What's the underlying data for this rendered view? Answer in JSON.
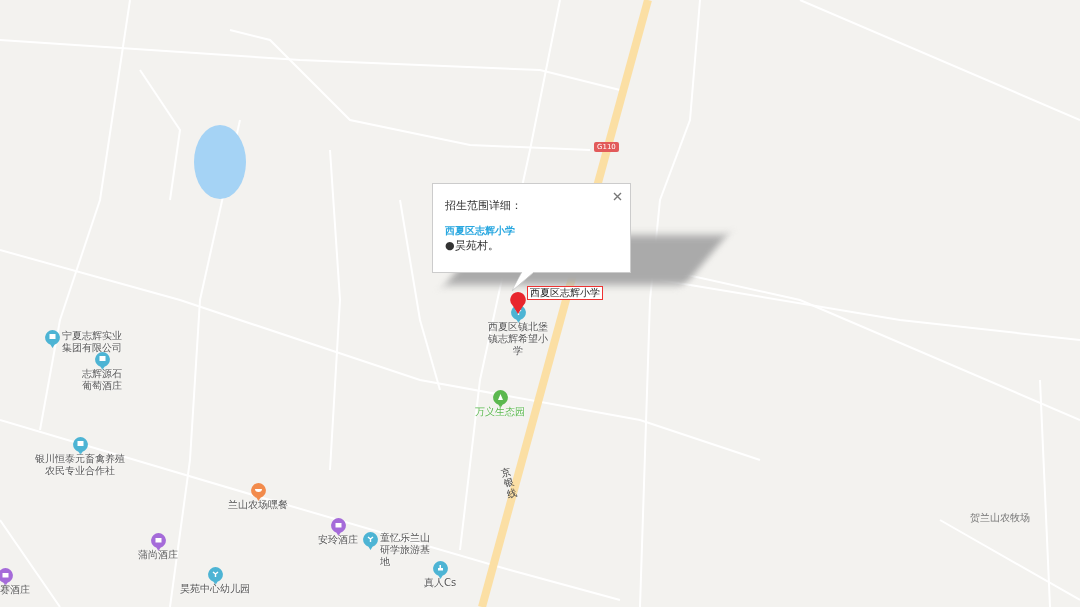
{
  "map": {
    "popup": {
      "title": "招生范围详细：",
      "school": "西夏区志辉小学",
      "items": [
        "●昊苑村。"
      ]
    },
    "marker_label": "西夏区志辉小学",
    "road_shield": "G110",
    "road_label": "京银线",
    "pois": [
      {
        "name": "宁夏志辉实业集团有限公司",
        "kind": "building",
        "color": "#4db4d4"
      },
      {
        "name": "志辉源石葡萄酒庄",
        "kind": "building",
        "color": "#4db4d4"
      },
      {
        "name": "银川恒泰元畜禽养殖农民专业合作社",
        "kind": "building",
        "color": "#4db4d4"
      },
      {
        "name": "兰山农场嘿餐",
        "kind": "food",
        "color": "#f28b4c"
      },
      {
        "name": "蒲尚酒庄",
        "kind": "shop",
        "color": "#a56bd9"
      },
      {
        "name": "安玲酒庄",
        "kind": "shop",
        "color": "#a56bd9"
      },
      {
        "name": "童忆乐兰山研学旅游基地",
        "kind": "school",
        "color": "#4db4d4"
      },
      {
        "name": "真人Cs",
        "kind": "play",
        "color": "#4db4d4"
      },
      {
        "name": "赛酒庄",
        "kind": "shop",
        "color": "#a56bd9"
      },
      {
        "name": "昊苑中心幼儿园",
        "kind": "school",
        "color": "#4db4d4"
      },
      {
        "name": "万义生态园",
        "kind": "park",
        "color": "#5bb84f"
      },
      {
        "name": "西夏区镇北堡镇志辉希望小学",
        "kind": "school",
        "color": "#4db4d4"
      }
    ],
    "place_labels": [
      "贺兰山农牧场"
    ]
  }
}
